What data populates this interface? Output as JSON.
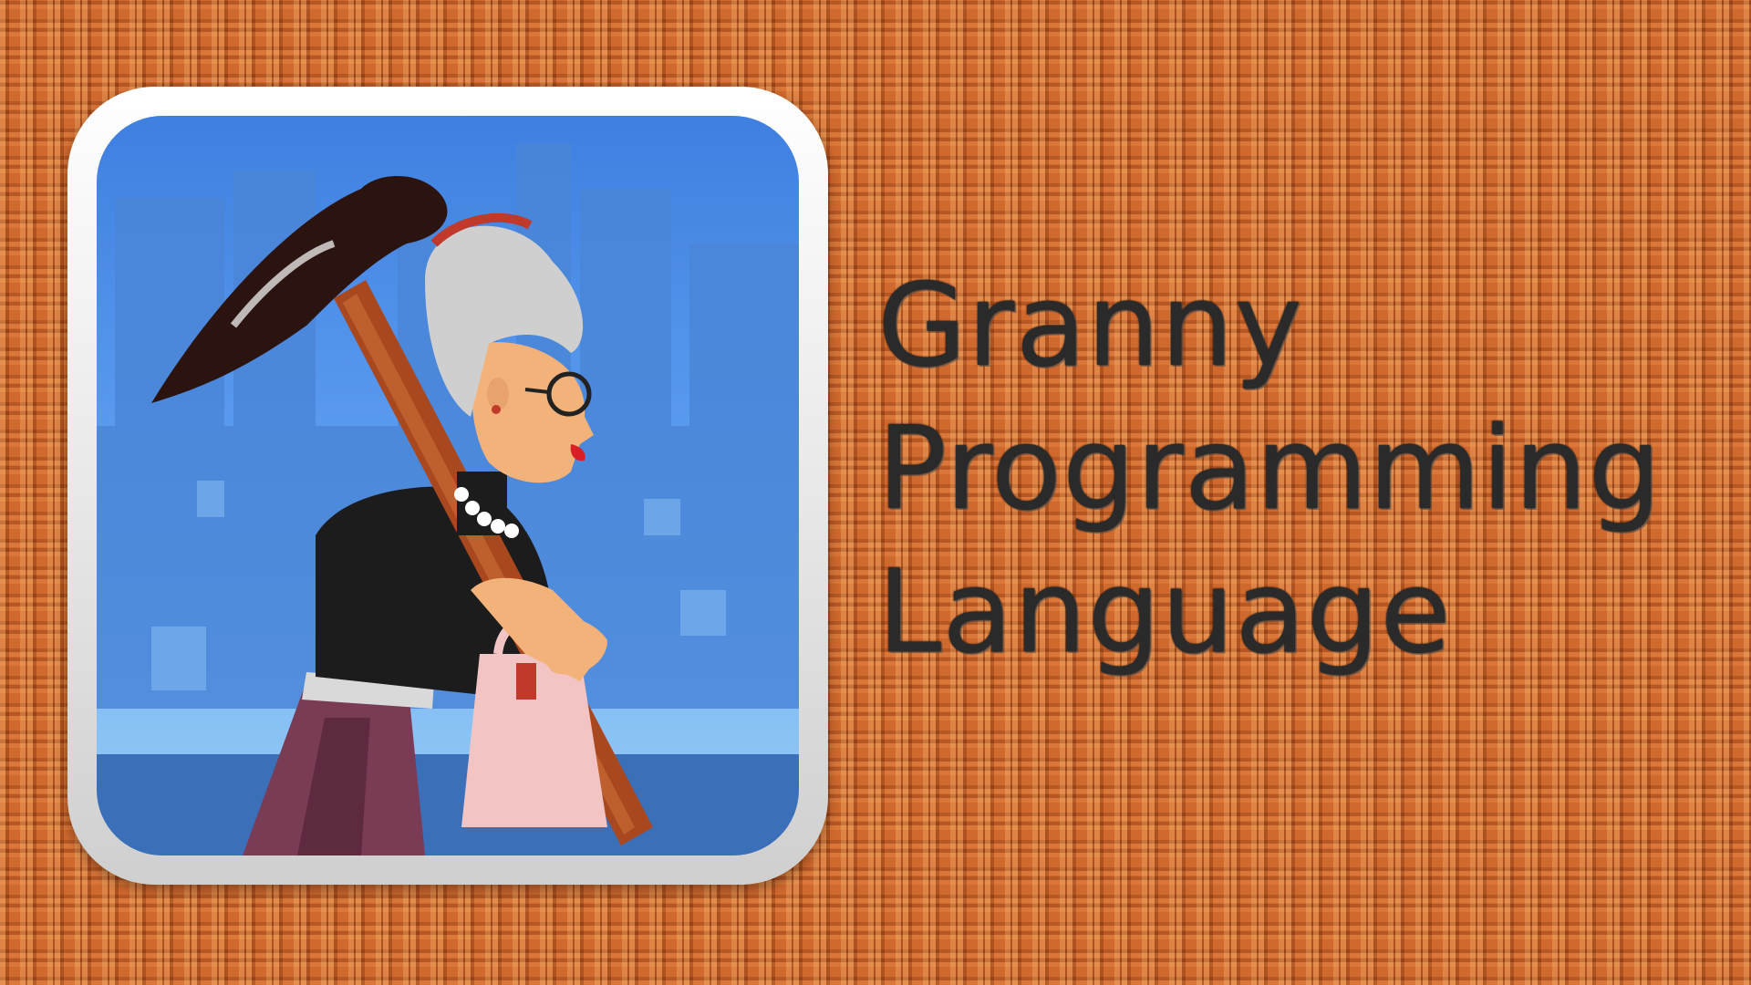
{
  "title": {
    "lines": [
      "Granny",
      "Programming",
      "Language"
    ]
  },
  "icon": {
    "semantic": "angry-granny-app-icon"
  },
  "colors": {
    "background": "#c9652a",
    "title_text": "#2a2a2a",
    "icon_sky": "#5b9cf0",
    "icon_frame": "#ffffff"
  }
}
